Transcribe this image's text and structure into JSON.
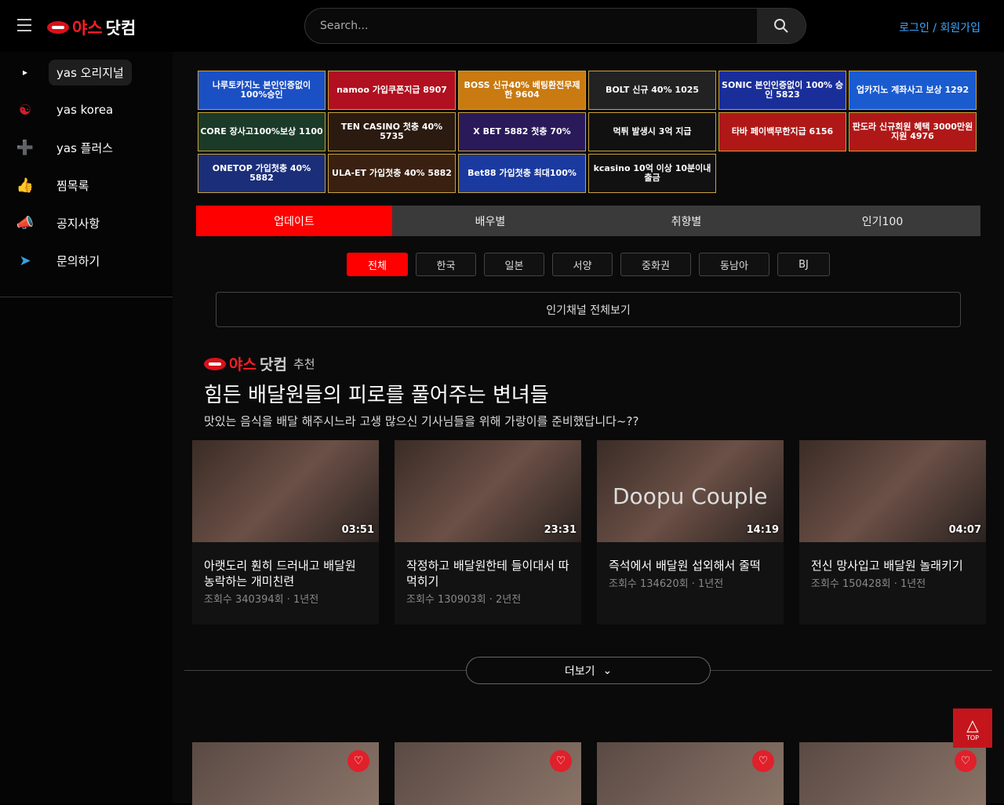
{
  "header": {
    "logo_red": "야스",
    "logo_white": "닷컴",
    "search_placeholder": "Search...",
    "login": "로그인 / 회원가입"
  },
  "sidebar": {
    "items": [
      {
        "label": "yas 오리지널",
        "icon": "play-icon",
        "glyph": "▸"
      },
      {
        "label": "yas korea",
        "icon": "taegeuk-icon",
        "glyph": "☯"
      },
      {
        "label": "yas 플러스",
        "icon": "plus-icon",
        "glyph": "➕"
      },
      {
        "label": "찜목록",
        "icon": "thumbs-up-heart-icon",
        "glyph": "👍"
      },
      {
        "label": "공지사항",
        "icon": "megaphone-icon",
        "glyph": "📣"
      },
      {
        "label": "문의하기",
        "icon": "send-icon",
        "glyph": "➤"
      }
    ]
  },
  "banners": [
    {
      "text": "나루토카지노 본인인증없이 100%승인",
      "bg": "#1b4fc4"
    },
    {
      "text": "namoo 가입쿠폰지급 8907",
      "bg": "#b01020"
    },
    {
      "text": "BOSS 신규40% 베팅환전무제한 9604",
      "bg": "#c97a10"
    },
    {
      "text": "BOLT 신규 40% 1025",
      "bg": "#222"
    },
    {
      "text": "SONIC 본인인증없이 100% 승인 5823",
      "bg": "#1a2e9a"
    },
    {
      "text": "업카지노 계좌사고 보상 1292",
      "bg": "#1a5bd0"
    },
    {
      "text": "CORE 장사고100%보상 1100",
      "bg": "#1b3a28"
    },
    {
      "text": "TEN CASINO 첫충 40% 5735",
      "bg": "#2a1a10"
    },
    {
      "text": "X BET 5882 첫충 70%",
      "bg": "#2a1a5a"
    },
    {
      "text": "먹튀 발생시 3억 지급",
      "bg": "#111"
    },
    {
      "text": "타바 페이백무한지급 6156",
      "bg": "#b01818"
    },
    {
      "text": "판도라 신규회원 혜택 3000만원 지원 4976",
      "bg": "#b01818"
    },
    {
      "text": "ONETOP 가입첫충 40% 5882",
      "bg": "#1b2e7a"
    },
    {
      "text": "ULA-ET 가입첫충 40% 5882",
      "bg": "#3a2010"
    },
    {
      "text": "Bet88 가입첫충 최대100%",
      "bg": "#1a3aa0"
    },
    {
      "text": "kcasino 10억 이상 10분이내 출금",
      "bg": "#111"
    }
  ],
  "tabs": [
    "업데이트",
    "배우별",
    "취향별",
    "인기100"
  ],
  "chips": [
    "전체",
    "한국",
    "일본",
    "서양",
    "중화권",
    "동남아",
    "BJ"
  ],
  "channels_button": "인기채널 전체보기",
  "recommend": {
    "tag": "추천",
    "title": "힘든 배달원들의 피로를 풀어주는 변녀들",
    "desc": "맛있는 음식을 배달 해주시느라 고생 많으신 기사님들을 위해 가랑이를 준비했답니다~??"
  },
  "videos": [
    {
      "title": "아랫도리 훤히 드러내고 배달원 농락하는 개미친련",
      "meta": "조회수 340394회 · 1년전",
      "duration": "03:51"
    },
    {
      "title": "작정하고 배달원한테 들이대서 따먹히기",
      "meta": "조회수 130903회 · 2년전",
      "duration": "23:31"
    },
    {
      "title": "즉석에서 배달원 섭외해서 줄떡",
      "meta": "조회수 134620회 · 1년전",
      "duration": "14:19",
      "overlay": "Doopu Couple"
    },
    {
      "title": "전신 망사입고 배달원 놀래키기",
      "meta": "조회수 150428회 · 1년전",
      "duration": "04:07"
    }
  ],
  "more_button": "더보기",
  "top_button": "TOP"
}
